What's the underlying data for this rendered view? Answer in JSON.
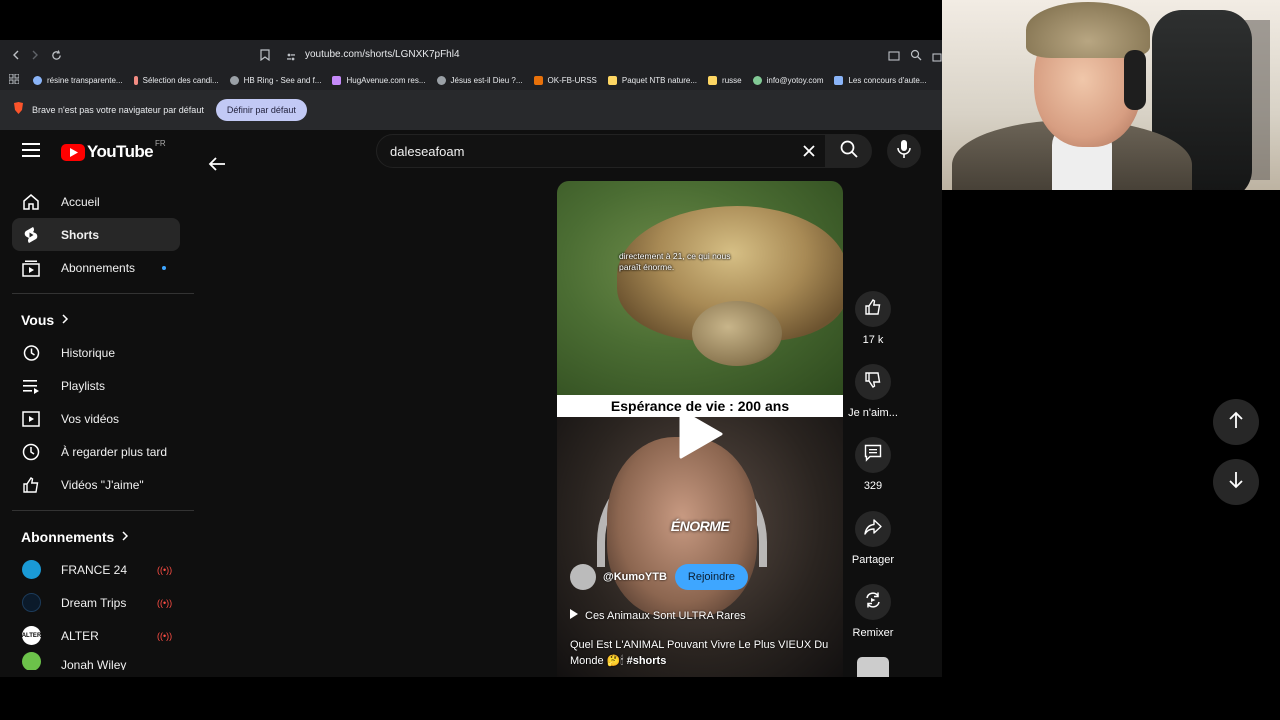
{
  "browser": {
    "url": "youtube.com/shorts/LGNXK7pFhl4",
    "bookmarks": [
      {
        "label": "résine transparente...",
        "color": "#8ab4f8"
      },
      {
        "label": "Sélection des candi...",
        "color": "#f28b82"
      },
      {
        "label": "HB Ring - See and f...",
        "color": "#9aa0a6"
      },
      {
        "label": "HugAvenue.com res...",
        "color": "#c58af9"
      },
      {
        "label": "Jésus est-il Dieu ?...",
        "color": "#9aa0a6"
      },
      {
        "label": "OK-FB-URSS",
        "color": "#e8710a"
      },
      {
        "label": "Paquet NTB nature...",
        "color": "#fdd663"
      },
      {
        "label": "russe",
        "color": "#fdd663"
      },
      {
        "label": "info@yotoy.com",
        "color": "#81c995"
      },
      {
        "label": "Les concours d'aute...",
        "color": "#8ab4f8"
      }
    ],
    "infobar": {
      "message": "Brave n'est pas votre navigateur par défaut",
      "button": "Définir par défaut"
    }
  },
  "youtube": {
    "logo_text": "YouTube",
    "country": "FR",
    "search_value": "daleseafoam",
    "sidebar": {
      "main": [
        {
          "label": "Accueil",
          "icon": "home-icon"
        },
        {
          "label": "Shorts",
          "icon": "shorts-icon"
        },
        {
          "label": "Abonnements",
          "icon": "subscriptions-icon"
        }
      ],
      "you_title": "Vous",
      "you": [
        {
          "label": "Historique",
          "icon": "history-icon"
        },
        {
          "label": "Playlists",
          "icon": "playlists-icon"
        },
        {
          "label": "Vos vidéos",
          "icon": "your-videos-icon"
        },
        {
          "label": "À regarder plus tard",
          "icon": "watch-later-icon"
        },
        {
          "label": "Vidéos \"J'aime\"",
          "icon": "liked-videos-icon"
        }
      ],
      "subs_title": "Abonnements",
      "subs": [
        {
          "label": "FRANCE 24",
          "live": "((•))",
          "color": "#1a9ad6",
          "initials": ""
        },
        {
          "label": "Dream Trips",
          "live": "((•))",
          "color": "#0b1a2a",
          "initials": ""
        },
        {
          "label": "ALTER",
          "live": "((•))",
          "color": "#ffffff",
          "initials": "ALTER"
        },
        {
          "label": "Jonah Wiley",
          "live": "",
          "color": "#6cc24a",
          "initials": ""
        }
      ]
    },
    "short": {
      "caption_top": "directement à 21, ce qui nous paraît énorme.",
      "lifespan_banner": "Espérance de vie : 200 ans",
      "overlay_word": "ÉNORME",
      "channel": "@KumoYTB",
      "join_label": "Rejoindre",
      "playlist": "Ces Animaux Sont ULTRA Rares",
      "title": "Quel Est L'ANIMAL Pouvant Vivre Le Plus VIEUX Du Monde 🤔🕯",
      "hashtag": "#shorts"
    },
    "actions": {
      "likes": "17 k",
      "dislike_label": "Je n'aim...",
      "comments": "329",
      "share_label": "Partager",
      "remix_label": "Remixer"
    }
  }
}
